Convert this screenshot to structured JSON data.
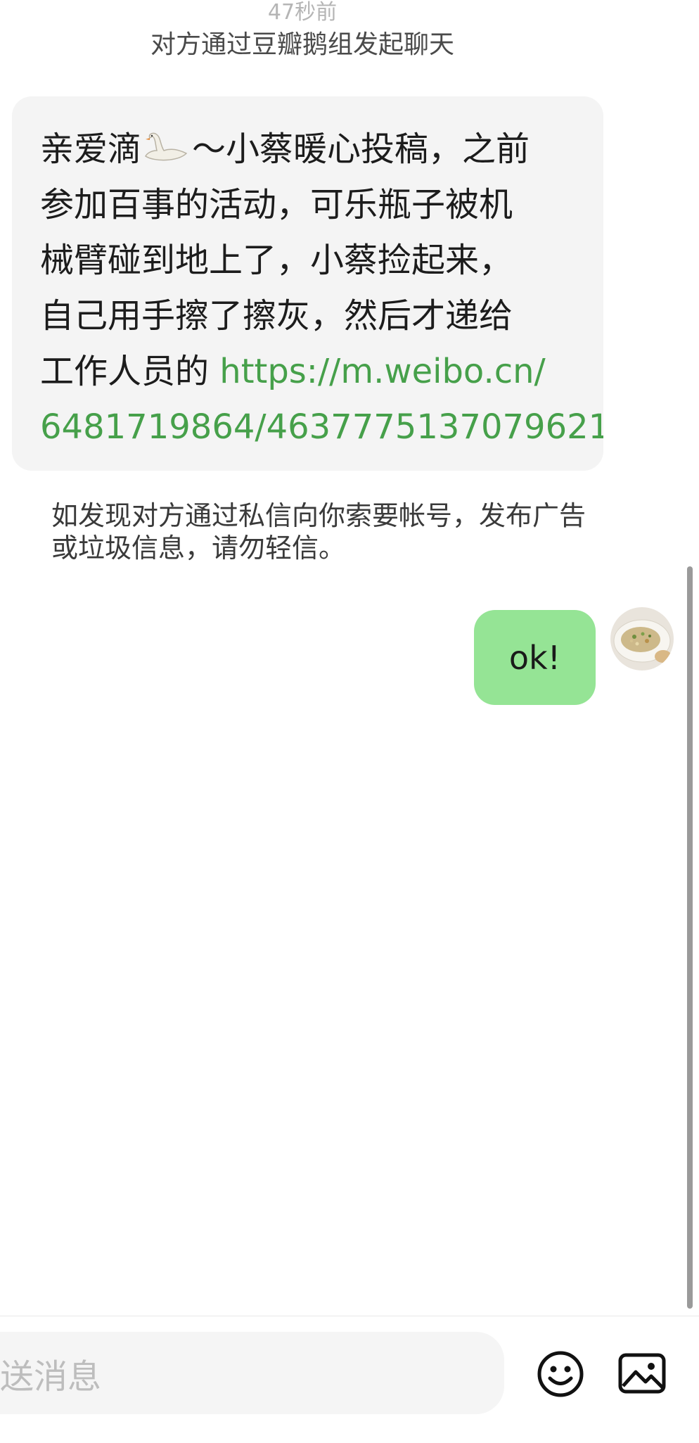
{
  "chat": {
    "timestamp": "47秒前",
    "system_note": "对方通过豆瓣鹅组发起聊天"
  },
  "incoming_message": {
    "lines": [
      {
        "before_icon": "亲爱滴",
        "icon": "swan-emoji",
        "after_icon": "～小蔡暖心投稿，之前"
      },
      {
        "text": "参加百事的活动，可乐瓶子被机"
      },
      {
        "text": "械臂碰到地上了，小蔡捡起来，"
      },
      {
        "text": "自己用手擦了擦灰，然后才递给"
      },
      {
        "text": "工作人员的 ",
        "link": "https://m.weibo.cn/"
      },
      {
        "link": "6481719864/4637775137079621"
      }
    ]
  },
  "warning_text": "如发现对方通过私信向你索要帐号，发布广告或垃圾信息，请勿轻信。",
  "outgoing_message": {
    "text": "ok!",
    "avatar": "food-plate-avatar"
  },
  "composer": {
    "placeholder": "送消息",
    "emoji_icon": "smiley-icon",
    "image_icon": "image-icon"
  },
  "colors": {
    "incoming_bubble": "#f4f4f4",
    "outgoing_bubble": "#95e495",
    "link": "#46a04a"
  }
}
